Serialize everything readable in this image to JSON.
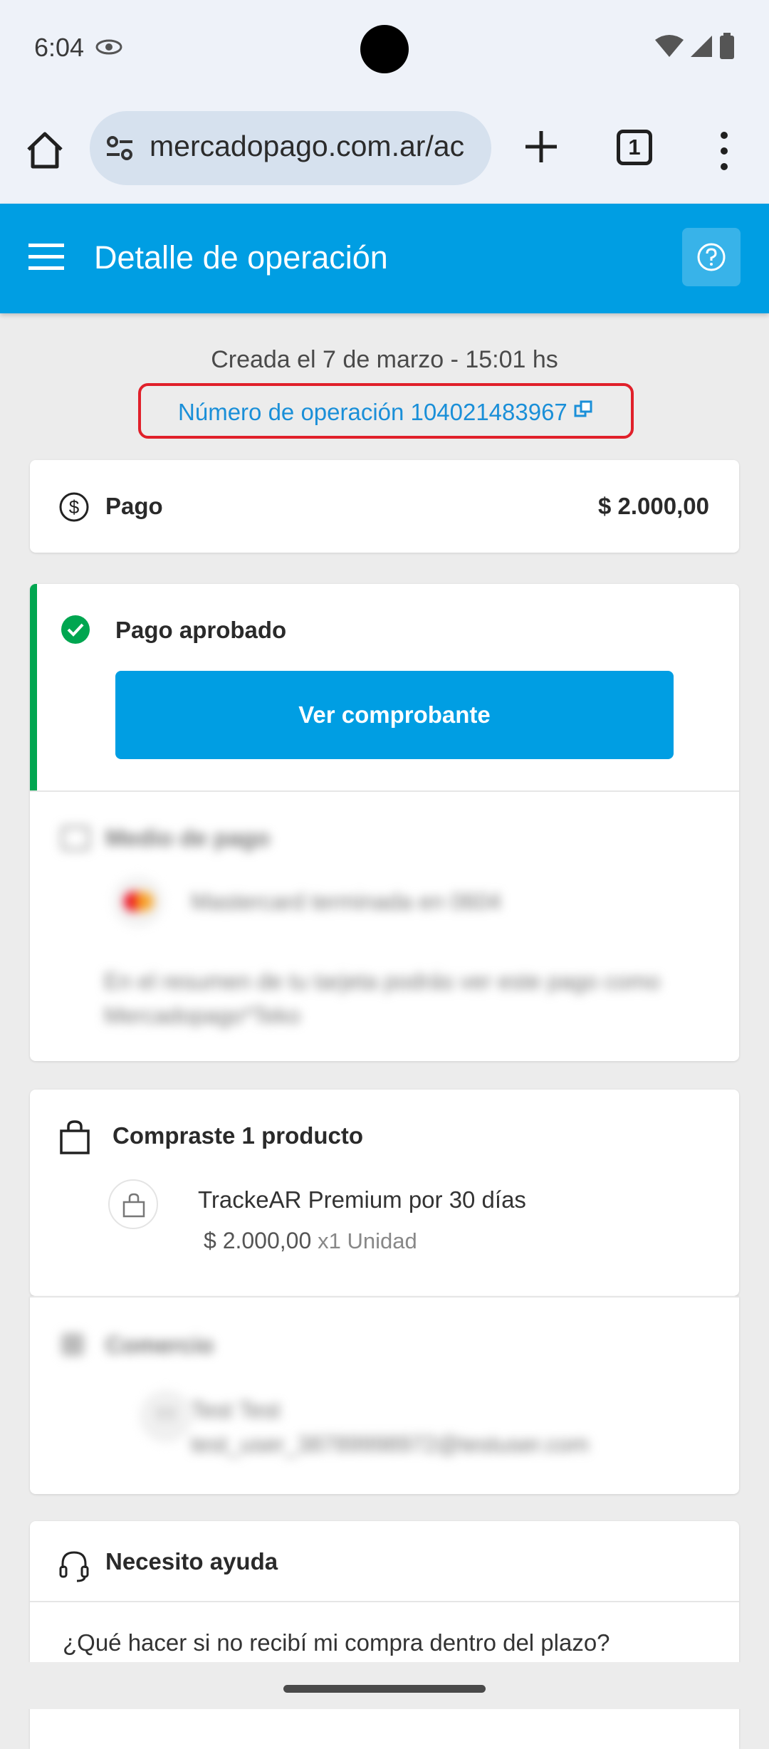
{
  "status_bar": {
    "time": "6:04"
  },
  "browser": {
    "url": "mercadopago.com.ar/ac",
    "tab_count": "1"
  },
  "header": {
    "title": "Detalle de operación"
  },
  "operation": {
    "created": "Creada el 7 de marzo - 15:01 hs",
    "number_text": "Número de operación 104021483967"
  },
  "payment": {
    "label": "Pago",
    "amount": "$ 2.000,00"
  },
  "status": {
    "label": "Pago aprobado",
    "button": "Ver comprobante"
  },
  "payment_method": {
    "title": "Medio de pago",
    "card_text": "Mastercard terminada en 0604",
    "note": "En el resumen de tu tarjeta podrás ver este pago como Mercadopago*Teko"
  },
  "purchase": {
    "title": "Compraste 1 producto",
    "product_name": "TrackeAR Premium por 30 días",
    "product_price": "$ 2.000,00",
    "product_units": "x1 Unidad"
  },
  "merchant": {
    "title": "Comercio",
    "avatar": "TT",
    "name": "Test Test",
    "email": "test_user_38789998972@testuser.com"
  },
  "help": {
    "title": "Necesito ayuda",
    "question": "¿Qué hacer si no recibí mi compra dentro del plazo?"
  },
  "colors": {
    "brand_blue": "#009ee3",
    "approved_green": "#00a650",
    "highlight_red": "#e0202a"
  }
}
